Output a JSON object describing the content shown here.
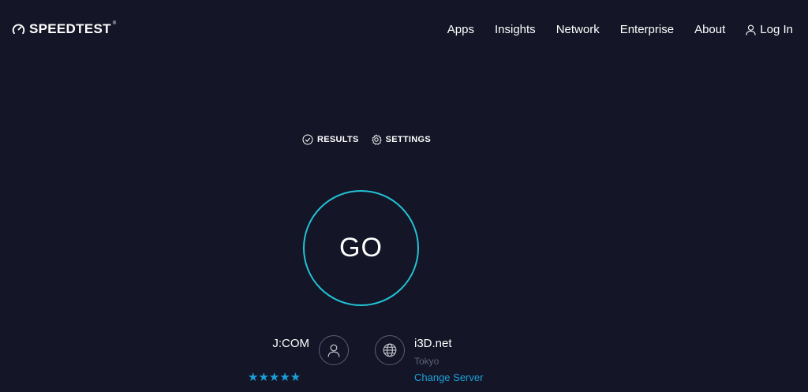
{
  "header": {
    "logo_text": "SPEEDTEST",
    "logo_tm": "®",
    "nav": {
      "apps": "Apps",
      "insights": "Insights",
      "network": "Network",
      "enterprise": "Enterprise",
      "about": "About",
      "login": "Log In"
    }
  },
  "tabs": {
    "results": "RESULTS",
    "settings": "SETTINGS"
  },
  "go_button": {
    "label": "GO"
  },
  "isp": {
    "name": "J:COM",
    "rating_stars": 5,
    "stars": "★★★★★"
  },
  "server": {
    "name": "i3D.net",
    "location": "Tokyo",
    "change_label": "Change Server"
  },
  "colors": {
    "background": "#141526",
    "go_ring": "#22c2d6",
    "accent_blue": "#1da1dc",
    "muted_text": "#5f6278"
  },
  "icons": {
    "logo": "gauge-icon",
    "login": "user-icon",
    "results": "check-circle-icon",
    "settings": "gear-icon",
    "isp": "person-icon",
    "server": "globe-icon"
  }
}
